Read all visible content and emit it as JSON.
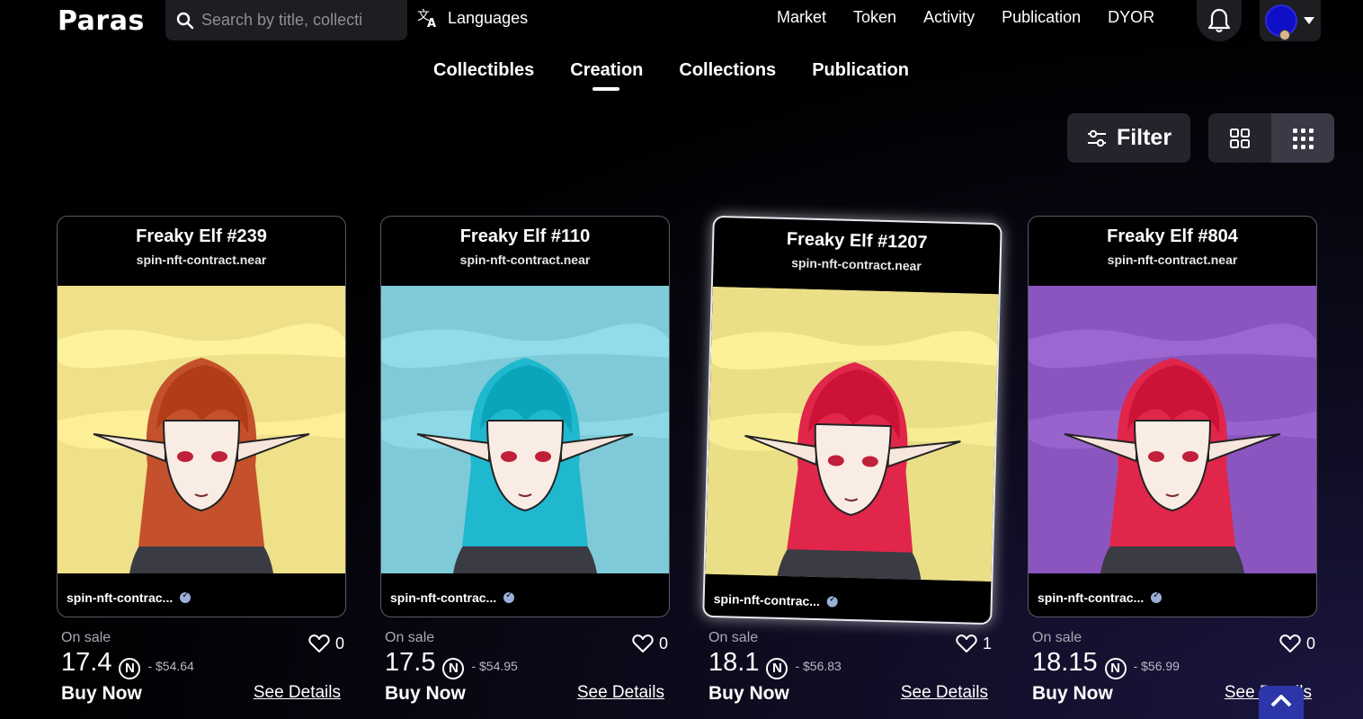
{
  "header": {
    "logo": "Paras",
    "search_placeholder": "Search by title, collecti",
    "languages_label": "Languages",
    "nav": [
      "Market",
      "Token",
      "Activity",
      "Publication",
      "DYOR"
    ]
  },
  "tabs": [
    {
      "label": "Collectibles",
      "active": false
    },
    {
      "label": "Creation",
      "active": true
    },
    {
      "label": "Collections",
      "active": false
    },
    {
      "label": "Publication",
      "active": false
    }
  ],
  "toolbar": {
    "filter_label": "Filter",
    "view_modes": [
      "grid-large",
      "grid-small"
    ],
    "selected_view": "grid-small"
  },
  "cards": [
    {
      "title": "Freaky Elf #239",
      "contract": "spin-nft-contract.near",
      "creator": "spin-nft-contrac...",
      "status": "On sale",
      "likes": "0",
      "price": "17.4",
      "usd": "- $54.64",
      "buy_label": "Buy Now",
      "details_label": "See Details",
      "bg_color": "#efe08a",
      "hair_color": "#c4512b"
    },
    {
      "title": "Freaky Elf #110",
      "contract": "spin-nft-contract.near",
      "creator": "spin-nft-contrac...",
      "status": "On sale",
      "likes": "0",
      "price": "17.5",
      "usd": "- $54.95",
      "buy_label": "Buy Now",
      "details_label": "See Details",
      "bg_color": "#7fcad8",
      "hair_color": "#1fb8cf"
    },
    {
      "title": "Freaky Elf #1207",
      "contract": "spin-nft-contract.near",
      "creator": "spin-nft-contrac...",
      "status": "On sale",
      "likes": "1",
      "price": "18.1",
      "usd": "- $56.83",
      "buy_label": "Buy Now",
      "details_label": "See Details",
      "bg_color": "#eadf86",
      "hair_color": "#e0264a"
    },
    {
      "title": "Freaky Elf #804",
      "contract": "spin-nft-contract.near",
      "creator": "spin-nft-contrac...",
      "status": "On sale",
      "likes": "0",
      "price": "18.15",
      "usd": "- $56.99",
      "buy_label": "Buy Now",
      "details_label": "See Details",
      "bg_color": "#8b55bf",
      "hair_color": "#e0264a"
    }
  ],
  "colors": {
    "accent": "#2c36a8",
    "panel": "#24242c",
    "avatar": "#0f0fc8"
  }
}
